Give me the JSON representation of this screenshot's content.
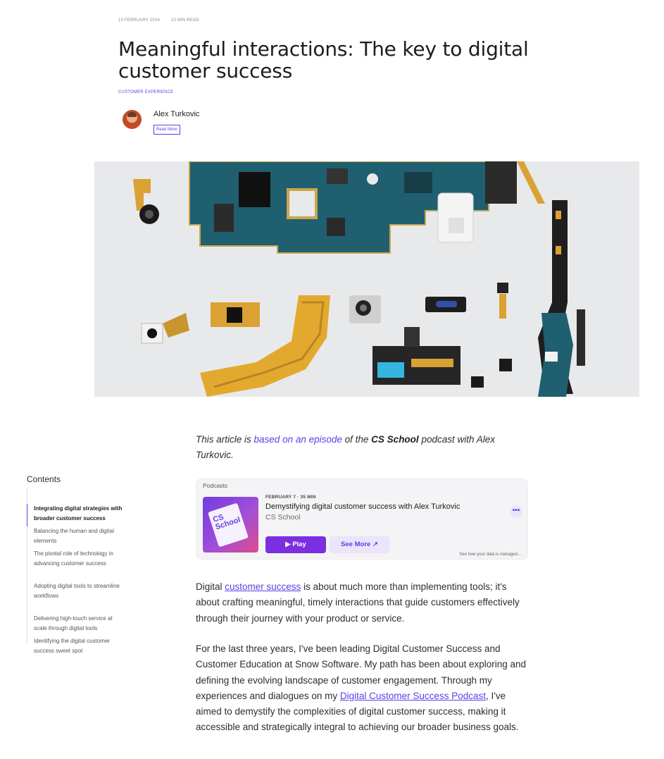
{
  "meta": {
    "date": "13 FEBRUARY 2024",
    "read_time": "10 MIN READ"
  },
  "title": "Meaningful interactions: The key to digital customer success",
  "category": "CUSTOMER EXPERIENCE",
  "author": {
    "name": "Alex Turkovic",
    "read_more": "Read More"
  },
  "toc": {
    "heading": "Contents",
    "items": [
      "Integrating digital strategies with broader customer success",
      "Balancing the human and digital elements",
      "The pivotal role of technology in advancing customer success",
      "Adopting digital tools to streamline workflows",
      "Delivering high-touch service at scale through digital tools",
      "Identifying the digital customer success sweet spot"
    ]
  },
  "intro": {
    "prefix": "This article is ",
    "link": "based on an episode",
    "middle": " of the ",
    "show": "CS School",
    "suffix": " podcast with Alex Turkovic."
  },
  "podcast": {
    "brand": "Podcasts",
    "art_text": "CS School",
    "date": "FEBRUARY 7 · 35 MIN",
    "episode_title": "Demystifying digital customer success with Alex Turkovic",
    "show": "CS School",
    "play_label": "Play",
    "see_more_label": "See More",
    "note": "See how your data is managed..."
  },
  "body": {
    "p1": {
      "prefix": "Digital ",
      "link": "customer success",
      "suffix": " is about much more than implementing tools; it's about crafting meaningful, timely interactions that guide customers effectively through their journey with your product or service."
    },
    "p2": {
      "prefix": "For the last three years, I've been leading Digital Customer Success and Customer Education at Snow Software. My path has been about exploring and defining the evolving landscape of customer engagement. Through my experiences and dialogues on my ",
      "link": "Digital Customer Success Podcast",
      "suffix": ", I've aimed to demystify the complexities of digital customer success, making it accessible and strategically integral to achieving our broader business goals."
    }
  },
  "colors": {
    "accent": "#5b3ee8",
    "play": "#7b2fe0"
  }
}
